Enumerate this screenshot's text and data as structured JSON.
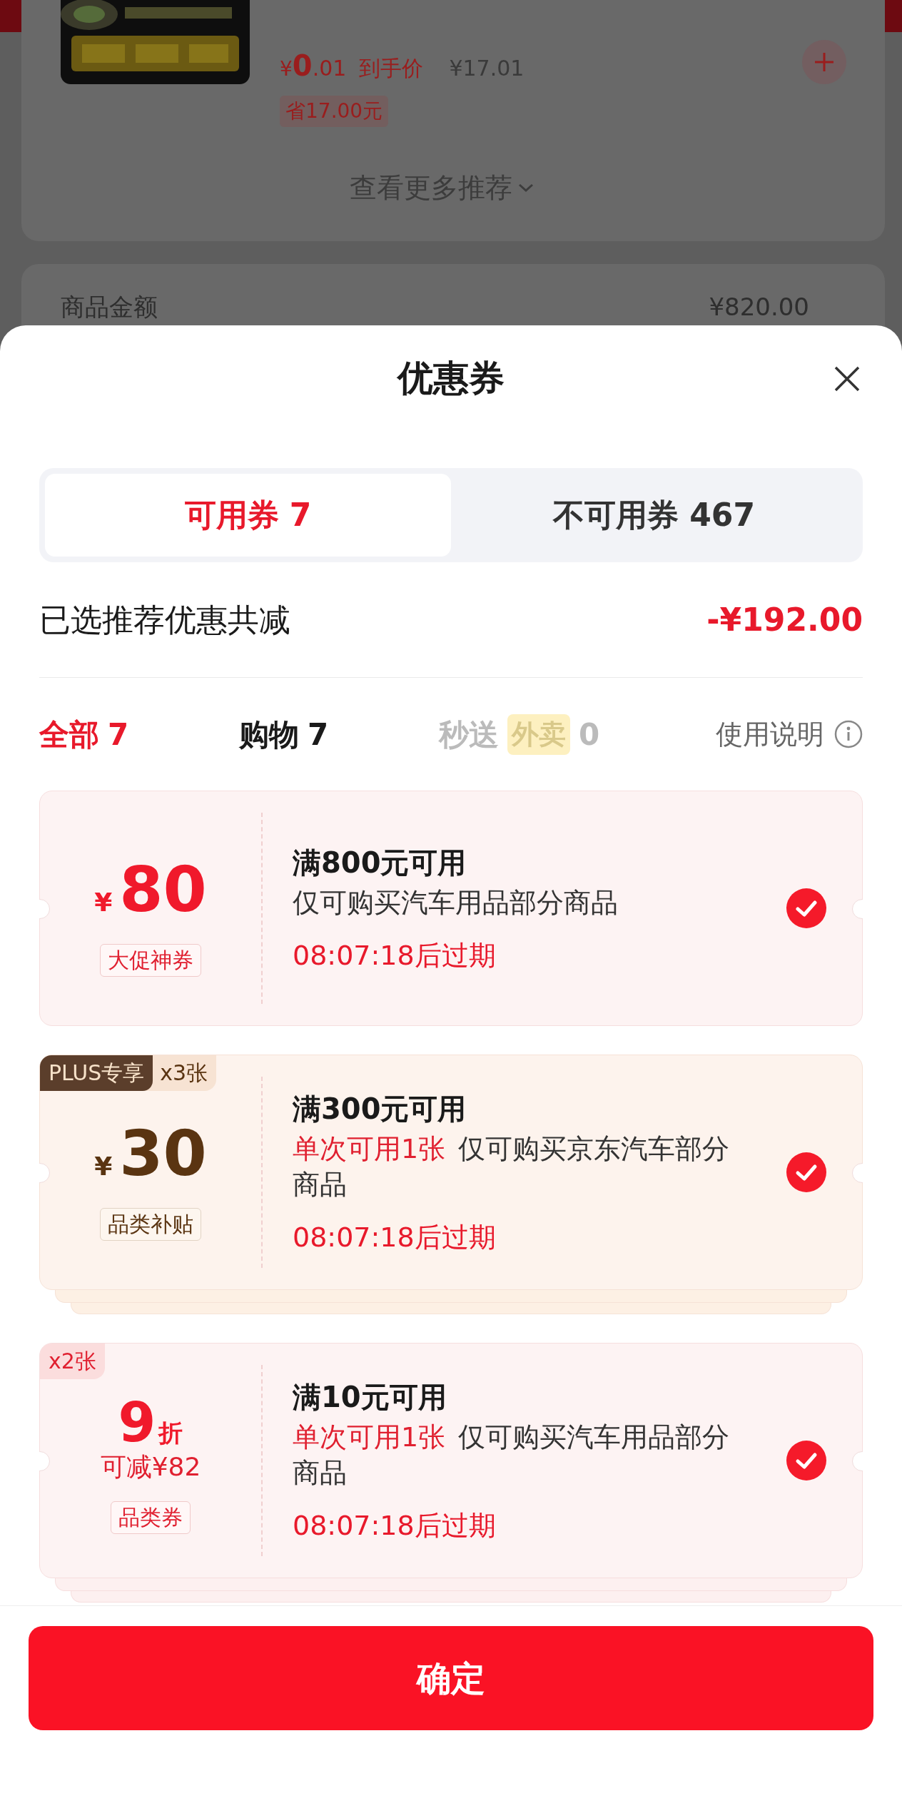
{
  "background": {
    "product": {
      "currency": "¥",
      "price_int": "0",
      "price_dec": ".01",
      "price_label": "到手价",
      "original_price": "¥17.01",
      "saving": "省17.00元"
    },
    "more_link": "查看更多推荐",
    "summary_row": {
      "label": "商品金额",
      "value": "¥820.00"
    }
  },
  "sheet": {
    "title": "优惠券",
    "tabs": [
      {
        "label": "可用券 7",
        "selected": true
      },
      {
        "label": "不可用券 467",
        "selected": false
      }
    ],
    "total": {
      "label": "已选推荐优惠共减",
      "value": "-¥192.00"
    },
    "filters": [
      {
        "label": "全部",
        "count": "7",
        "selected": true,
        "disabled": false
      },
      {
        "label": "购物",
        "count": "7",
        "selected": false,
        "disabled": false
      },
      {
        "label": "秒送",
        "tag": "外卖",
        "count": "0",
        "selected": false,
        "disabled": true
      }
    ],
    "help": "使用说明",
    "coupons": [
      {
        "kind": "amount",
        "currency": "¥",
        "value": "80",
        "tag": "大促神券",
        "condition": "满800元可用",
        "scope": "仅可购买汽车用品部分商品",
        "expiry": "08:07:18后过期",
        "checked": true,
        "stacked": false
      },
      {
        "kind": "amount",
        "currency": "¥",
        "value": "30",
        "tag": "品类补贴",
        "badges": [
          {
            "text": "PLUS专享",
            "kind": "plus"
          },
          {
            "text": "x3张",
            "kind": "count"
          }
        ],
        "condition": "满300元可用",
        "limit": "单次可用1张",
        "scope": "仅可购买京东汽车部分商品",
        "expiry": "08:07:18后过期",
        "checked": true,
        "stacked": true
      },
      {
        "kind": "discount",
        "value": "9",
        "unit": "折",
        "savings": "可减¥82",
        "tag": "品类券",
        "badges": [
          {
            "text": "x2张",
            "kind": "count"
          }
        ],
        "condition": "满10元可用",
        "limit": "单次可用1张",
        "scope": "仅可购买汽车用品部分商品",
        "expiry": "08:07:18后过期",
        "checked": true,
        "stacked": true
      }
    ],
    "confirm": "确定"
  }
}
